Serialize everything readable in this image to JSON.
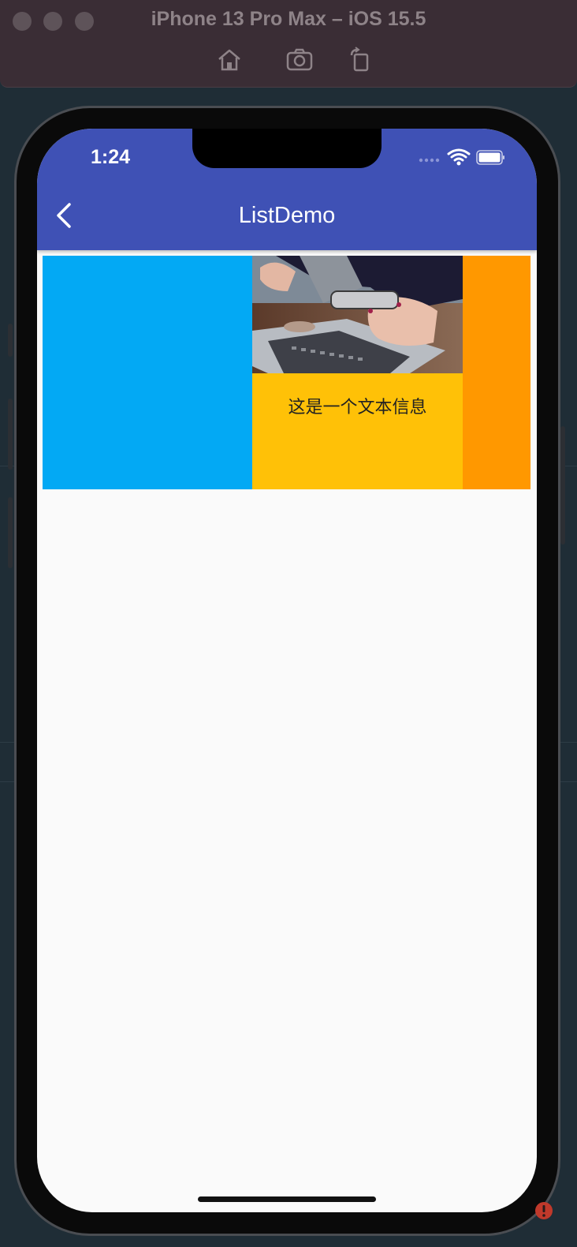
{
  "window": {
    "title": "iPhone 13 Pro Max – iOS 15.5",
    "toolbar_icons": [
      "home-icon",
      "screenshot-icon",
      "rotate-icon"
    ]
  },
  "status_bar": {
    "time": "1:24",
    "icons": [
      "signal-icon",
      "wifi-icon",
      "battery-icon"
    ]
  },
  "app_bar": {
    "title": "ListDemo",
    "back_icon": "chevron-left-icon",
    "color": "#3f51b5"
  },
  "list": {
    "item": {
      "caption": "这是一个文本信息",
      "colors": {
        "left": "#03a9f4",
        "middle": "#ffc107",
        "right": "#ff9800"
      }
    }
  }
}
